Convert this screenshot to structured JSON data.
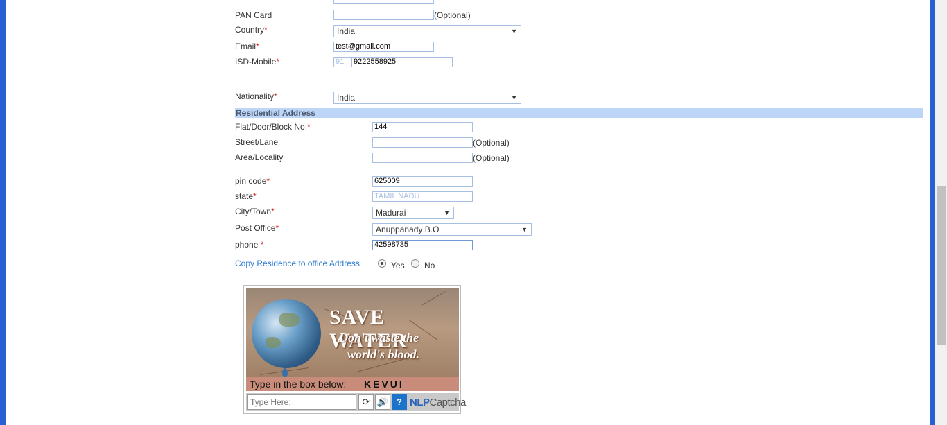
{
  "form": {
    "pan": {
      "label": "PAN Card",
      "value": "",
      "optional": "(Optional)"
    },
    "country": {
      "label": "Country",
      "req": "*",
      "value": "India"
    },
    "email": {
      "label": "Email",
      "req": "*",
      "value": "test@gmail.com"
    },
    "isd_mobile": {
      "label": "ISD-Mobile",
      "req": "*",
      "isd": "91",
      "value": "9222558925"
    },
    "nationality": {
      "label": "Nationality",
      "req": "*",
      "value": "India"
    }
  },
  "residential": {
    "section_title": "Residential Address",
    "flat": {
      "label": "Flat/Door/Block No.",
      "req": "*",
      "value": "144"
    },
    "street": {
      "label": "Street/Lane",
      "value": "",
      "optional": "(Optional)"
    },
    "area": {
      "label": "Area/Locality",
      "value": "",
      "optional": "(Optional)"
    },
    "pincode": {
      "label": "pin code",
      "req": "*",
      "value": "625009"
    },
    "state": {
      "label": "state",
      "req": "*",
      "value": "TAMIL NADU"
    },
    "city": {
      "label": "City/Town",
      "req": "*",
      "value": "Madurai"
    },
    "post_office": {
      "label": "Post Office",
      "req": "*",
      "value": "Anuppanady B.O"
    },
    "phone": {
      "label": "phone ",
      "req": "*",
      "value": "42598735"
    },
    "copy_link": "Copy Residence to office Address",
    "copy_yes": "Yes",
    "copy_no": "No"
  },
  "captcha": {
    "banner_title": "SAVE WATER",
    "banner_line1": "Don't waste the",
    "banner_line2": "world's blood.",
    "prompt": "Type in the box below:",
    "code": "KEVUI",
    "input_placeholder": "Type Here:",
    "refresh_icon": "refresh-icon",
    "audio_icon": "speaker-icon",
    "help_icon": "help-icon",
    "brand_main": "NLP",
    "brand_sub": "Captcha"
  },
  "colors": {
    "accent": "#2660d4",
    "section_bg": "#bdd6f7",
    "required": "#d21c1c",
    "link": "#2a7ad2"
  }
}
